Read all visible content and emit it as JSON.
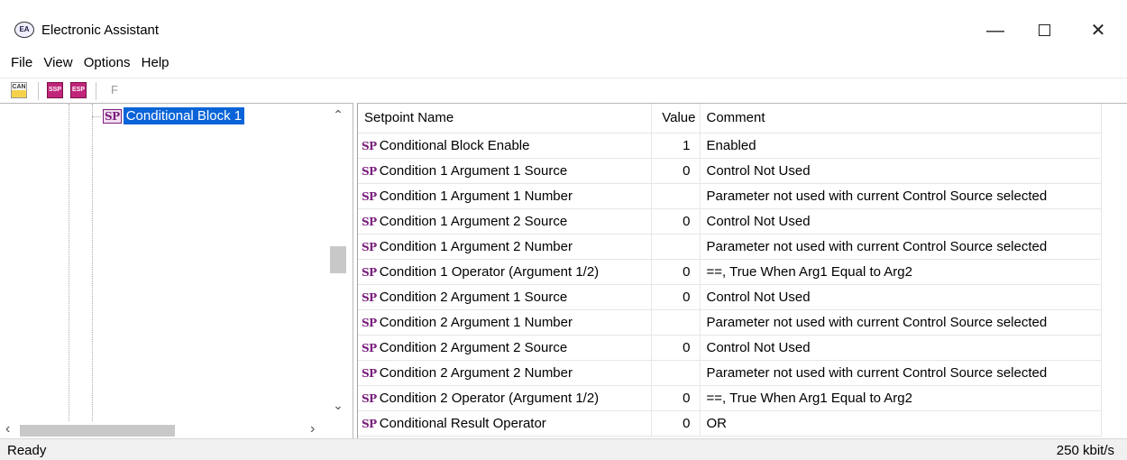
{
  "window": {
    "title": "Electronic Assistant",
    "icon": "electronic-assistant-logo",
    "icon_text": "EA",
    "controls": {
      "minimize": "—",
      "close": "✕"
    }
  },
  "menu": [
    "File",
    "View",
    "Options",
    "Help"
  ],
  "toolbar": {
    "can_label": "CAN",
    "ssp_label": "SSP",
    "esp_label": "ESP",
    "f_label": "F"
  },
  "tree": {
    "selected_node": {
      "badge": "SP",
      "label": "Conditional Block 1"
    }
  },
  "grid": {
    "columns": [
      "Setpoint Name",
      "Value",
      "Comment"
    ],
    "rows": [
      {
        "badge": "SP",
        "name": "Conditional Block Enable",
        "value": "1",
        "comment": "Enabled"
      },
      {
        "badge": "SP",
        "name": "Condition 1 Argument 1 Source",
        "value": "0",
        "comment": "Control Not Used"
      },
      {
        "badge": "SP",
        "name": "Condition 1 Argument 1 Number",
        "value": "",
        "comment": "Parameter not used with current Control Source selected"
      },
      {
        "badge": "SP",
        "name": "Condition 1 Argument 2 Source",
        "value": "0",
        "comment": "Control Not Used"
      },
      {
        "badge": "SP",
        "name": "Condition 1 Argument 2 Number",
        "value": "",
        "comment": "Parameter not used with current Control Source selected"
      },
      {
        "badge": "SP",
        "name": "Condition 1 Operator (Argument 1/2)",
        "value": "0",
        "comment": "==, True When Arg1 Equal to Arg2"
      },
      {
        "badge": "SP",
        "name": "Condition 2 Argument 1 Source",
        "value": "0",
        "comment": "Control Not Used"
      },
      {
        "badge": "SP",
        "name": "Condition 2 Argument 1 Number",
        "value": "",
        "comment": "Parameter not used with current Control Source selected"
      },
      {
        "badge": "SP",
        "name": "Condition 2 Argument 2 Source",
        "value": "0",
        "comment": "Control Not Used"
      },
      {
        "badge": "SP",
        "name": "Condition 2 Argument 2 Number",
        "value": "",
        "comment": "Parameter not used with current Control Source selected"
      },
      {
        "badge": "SP",
        "name": "Condition 2 Operator (Argument 1/2)",
        "value": "0",
        "comment": "==, True When Arg1 Equal to Arg2"
      },
      {
        "badge": "SP",
        "name": "Conditional Result Operator",
        "value": "0",
        "comment": "OR"
      }
    ]
  },
  "status": {
    "left": "Ready",
    "right": "250 kbit/s"
  },
  "colors": {
    "selection": "#0a64d8",
    "sp_badge": "#7a1f7e"
  }
}
